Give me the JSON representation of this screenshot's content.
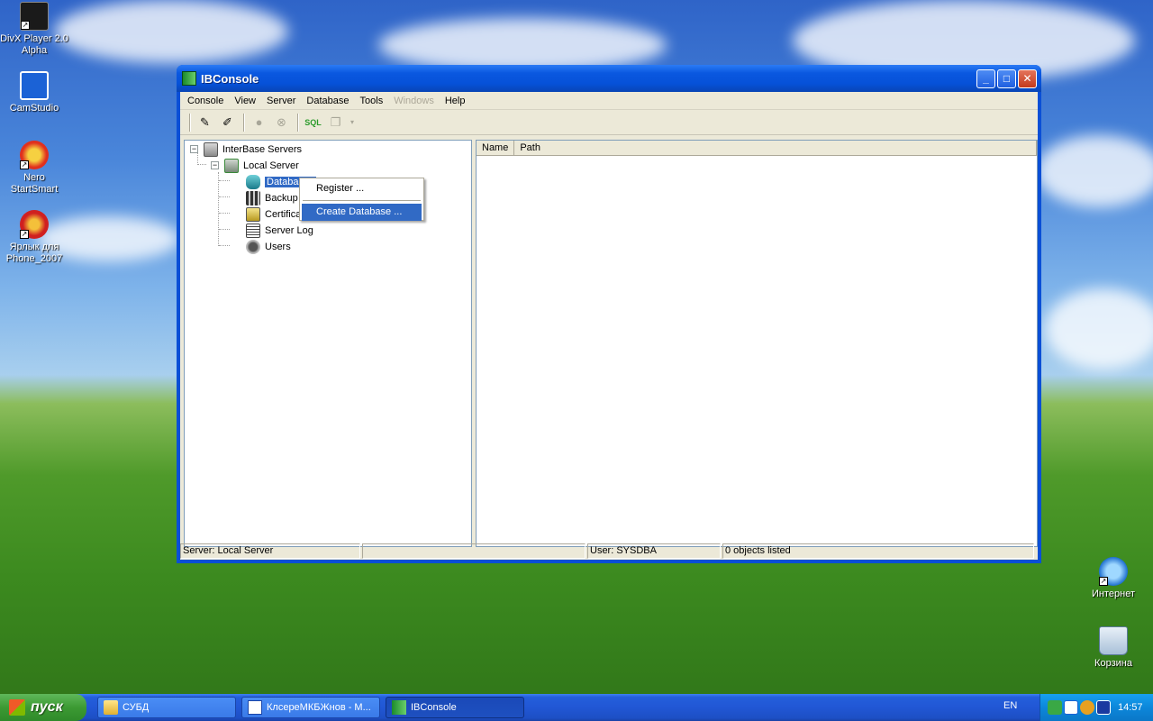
{
  "desktop": {
    "icons_left": [
      {
        "label": "DivX Player 2.0 Alpha",
        "icon": "divx-icon"
      },
      {
        "label": "CamStudio",
        "icon": "camstudio-icon"
      },
      {
        "label": "Nero StartSmart",
        "icon": "nero-icon"
      },
      {
        "label": "Ярлык для Phone_2007",
        "icon": "phone-icon"
      }
    ],
    "icons_right": [
      {
        "label": "Интернет",
        "icon": "internet-explorer-icon"
      },
      {
        "label": "Корзина",
        "icon": "recycle-bin-icon"
      }
    ]
  },
  "window": {
    "title": "IBConsole",
    "menu": [
      "Console",
      "View",
      "Server",
      "Database",
      "Tools",
      "Windows",
      "Help"
    ],
    "menu_disabled": "Windows",
    "tree": {
      "root": "InterBase Servers",
      "server": "Local Server",
      "children": [
        "Databases",
        "Backup",
        "Certificates",
        "Server Log",
        "Users"
      ]
    },
    "list_columns": [
      "Name",
      "Path"
    ],
    "context_menu": {
      "register": "Register ...",
      "create_database": "Create Database ..."
    },
    "status": {
      "server": "Server: Local Server",
      "blank": "",
      "user": "User: SYSDBA",
      "objects": "0 objects listed"
    }
  },
  "taskbar": {
    "start_label": "пуск",
    "tasks": [
      "СУБД",
      "КлсереМКБЖнов - M...",
      "IBConsole"
    ],
    "active_task": "IBConsole",
    "language": "EN",
    "clock": "14:57"
  }
}
